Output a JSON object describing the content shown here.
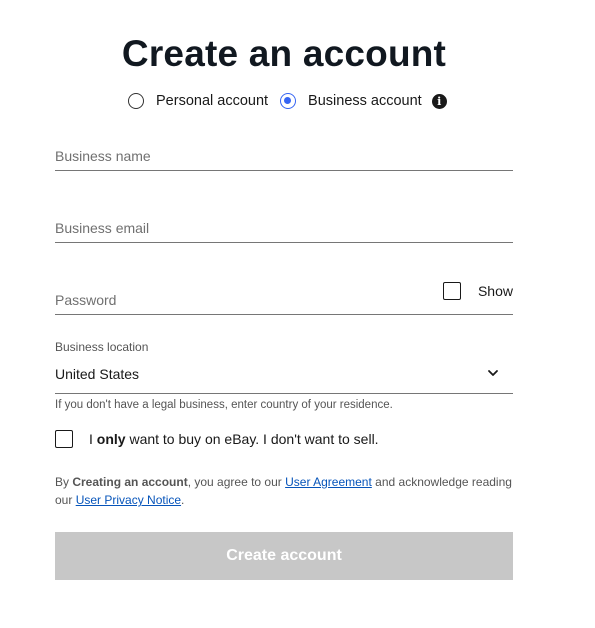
{
  "page": {
    "title": "Create an account"
  },
  "account_type": {
    "personal_label": "Personal account",
    "business_label": "Business account",
    "selected": "business",
    "info_icon": "info-icon"
  },
  "fields": {
    "business_name_placeholder": "Business name",
    "business_email_placeholder": "Business email",
    "password_placeholder": "Password",
    "show_label": "Show"
  },
  "location": {
    "label": "Business location",
    "value": "United States",
    "helper": "If you don't have a legal business, enter country of your residence."
  },
  "only_buy": {
    "prefix": "I ",
    "bold": "only",
    "suffix": " want to buy on eBay. I don't want to sell."
  },
  "legal": {
    "prefix": "By ",
    "bold": "Creating an account",
    "mid": ", you agree to our ",
    "link1": "User Agreement",
    "mid2": " and acknowledge reading our ",
    "link2": "User Privacy Notice",
    "end": "."
  },
  "submit": {
    "label": "Create account"
  },
  "colors": {
    "accent": "#3665f3",
    "link": "#0654ba",
    "disabled_button": "#c7c7c7"
  }
}
